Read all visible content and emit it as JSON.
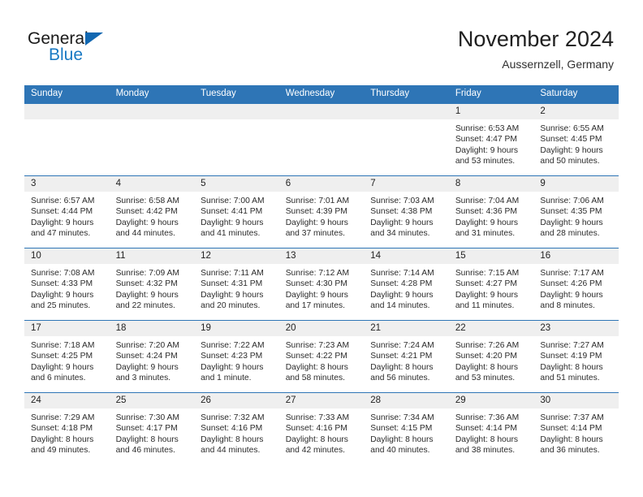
{
  "brand": {
    "name_part1": "General",
    "name_part2": "Blue",
    "triangle_icon": "triangle-icon",
    "accent_dark": "#1167b1",
    "accent_blue": "#1979c3"
  },
  "header": {
    "title": "November 2024",
    "subtitle": "Aussernzell, Germany"
  },
  "theme": {
    "header_blue": "#2e75b6",
    "band_gray": "#efefef",
    "text": "#222222"
  },
  "calendar": {
    "weekday_headers": [
      "Sunday",
      "Monday",
      "Tuesday",
      "Wednesday",
      "Thursday",
      "Friday",
      "Saturday"
    ],
    "weeks": [
      [
        {
          "day": "",
          "sunrise": "",
          "sunset": "",
          "daylight_line1": "",
          "daylight_line2": "",
          "empty": true
        },
        {
          "day": "",
          "sunrise": "",
          "sunset": "",
          "daylight_line1": "",
          "daylight_line2": "",
          "empty": true
        },
        {
          "day": "",
          "sunrise": "",
          "sunset": "",
          "daylight_line1": "",
          "daylight_line2": "",
          "empty": true
        },
        {
          "day": "",
          "sunrise": "",
          "sunset": "",
          "daylight_line1": "",
          "daylight_line2": "",
          "empty": true
        },
        {
          "day": "",
          "sunrise": "",
          "sunset": "",
          "daylight_line1": "",
          "daylight_line2": "",
          "empty": true
        },
        {
          "day": "1",
          "sunrise": "Sunrise: 6:53 AM",
          "sunset": "Sunset: 4:47 PM",
          "daylight_line1": "Daylight: 9 hours",
          "daylight_line2": "and 53 minutes.",
          "empty": false
        },
        {
          "day": "2",
          "sunrise": "Sunrise: 6:55 AM",
          "sunset": "Sunset: 4:45 PM",
          "daylight_line1": "Daylight: 9 hours",
          "daylight_line2": "and 50 minutes.",
          "empty": false
        }
      ],
      [
        {
          "day": "3",
          "sunrise": "Sunrise: 6:57 AM",
          "sunset": "Sunset: 4:44 PM",
          "daylight_line1": "Daylight: 9 hours",
          "daylight_line2": "and 47 minutes.",
          "empty": false
        },
        {
          "day": "4",
          "sunrise": "Sunrise: 6:58 AM",
          "sunset": "Sunset: 4:42 PM",
          "daylight_line1": "Daylight: 9 hours",
          "daylight_line2": "and 44 minutes.",
          "empty": false
        },
        {
          "day": "5",
          "sunrise": "Sunrise: 7:00 AM",
          "sunset": "Sunset: 4:41 PM",
          "daylight_line1": "Daylight: 9 hours",
          "daylight_line2": "and 41 minutes.",
          "empty": false
        },
        {
          "day": "6",
          "sunrise": "Sunrise: 7:01 AM",
          "sunset": "Sunset: 4:39 PM",
          "daylight_line1": "Daylight: 9 hours",
          "daylight_line2": "and 37 minutes.",
          "empty": false
        },
        {
          "day": "7",
          "sunrise": "Sunrise: 7:03 AM",
          "sunset": "Sunset: 4:38 PM",
          "daylight_line1": "Daylight: 9 hours",
          "daylight_line2": "and 34 minutes.",
          "empty": false
        },
        {
          "day": "8",
          "sunrise": "Sunrise: 7:04 AM",
          "sunset": "Sunset: 4:36 PM",
          "daylight_line1": "Daylight: 9 hours",
          "daylight_line2": "and 31 minutes.",
          "empty": false
        },
        {
          "day": "9",
          "sunrise": "Sunrise: 7:06 AM",
          "sunset": "Sunset: 4:35 PM",
          "daylight_line1": "Daylight: 9 hours",
          "daylight_line2": "and 28 minutes.",
          "empty": false
        }
      ],
      [
        {
          "day": "10",
          "sunrise": "Sunrise: 7:08 AM",
          "sunset": "Sunset: 4:33 PM",
          "daylight_line1": "Daylight: 9 hours",
          "daylight_line2": "and 25 minutes.",
          "empty": false
        },
        {
          "day": "11",
          "sunrise": "Sunrise: 7:09 AM",
          "sunset": "Sunset: 4:32 PM",
          "daylight_line1": "Daylight: 9 hours",
          "daylight_line2": "and 22 minutes.",
          "empty": false
        },
        {
          "day": "12",
          "sunrise": "Sunrise: 7:11 AM",
          "sunset": "Sunset: 4:31 PM",
          "daylight_line1": "Daylight: 9 hours",
          "daylight_line2": "and 20 minutes.",
          "empty": false
        },
        {
          "day": "13",
          "sunrise": "Sunrise: 7:12 AM",
          "sunset": "Sunset: 4:30 PM",
          "daylight_line1": "Daylight: 9 hours",
          "daylight_line2": "and 17 minutes.",
          "empty": false
        },
        {
          "day": "14",
          "sunrise": "Sunrise: 7:14 AM",
          "sunset": "Sunset: 4:28 PM",
          "daylight_line1": "Daylight: 9 hours",
          "daylight_line2": "and 14 minutes.",
          "empty": false
        },
        {
          "day": "15",
          "sunrise": "Sunrise: 7:15 AM",
          "sunset": "Sunset: 4:27 PM",
          "daylight_line1": "Daylight: 9 hours",
          "daylight_line2": "and 11 minutes.",
          "empty": false
        },
        {
          "day": "16",
          "sunrise": "Sunrise: 7:17 AM",
          "sunset": "Sunset: 4:26 PM",
          "daylight_line1": "Daylight: 9 hours",
          "daylight_line2": "and 8 minutes.",
          "empty": false
        }
      ],
      [
        {
          "day": "17",
          "sunrise": "Sunrise: 7:18 AM",
          "sunset": "Sunset: 4:25 PM",
          "daylight_line1": "Daylight: 9 hours",
          "daylight_line2": "and 6 minutes.",
          "empty": false
        },
        {
          "day": "18",
          "sunrise": "Sunrise: 7:20 AM",
          "sunset": "Sunset: 4:24 PM",
          "daylight_line1": "Daylight: 9 hours",
          "daylight_line2": "and 3 minutes.",
          "empty": false
        },
        {
          "day": "19",
          "sunrise": "Sunrise: 7:22 AM",
          "sunset": "Sunset: 4:23 PM",
          "daylight_line1": "Daylight: 9 hours",
          "daylight_line2": "and 1 minute.",
          "empty": false
        },
        {
          "day": "20",
          "sunrise": "Sunrise: 7:23 AM",
          "sunset": "Sunset: 4:22 PM",
          "daylight_line1": "Daylight: 8 hours",
          "daylight_line2": "and 58 minutes.",
          "empty": false
        },
        {
          "day": "21",
          "sunrise": "Sunrise: 7:24 AM",
          "sunset": "Sunset: 4:21 PM",
          "daylight_line1": "Daylight: 8 hours",
          "daylight_line2": "and 56 minutes.",
          "empty": false
        },
        {
          "day": "22",
          "sunrise": "Sunrise: 7:26 AM",
          "sunset": "Sunset: 4:20 PM",
          "daylight_line1": "Daylight: 8 hours",
          "daylight_line2": "and 53 minutes.",
          "empty": false
        },
        {
          "day": "23",
          "sunrise": "Sunrise: 7:27 AM",
          "sunset": "Sunset: 4:19 PM",
          "daylight_line1": "Daylight: 8 hours",
          "daylight_line2": "and 51 minutes.",
          "empty": false
        }
      ],
      [
        {
          "day": "24",
          "sunrise": "Sunrise: 7:29 AM",
          "sunset": "Sunset: 4:18 PM",
          "daylight_line1": "Daylight: 8 hours",
          "daylight_line2": "and 49 minutes.",
          "empty": false
        },
        {
          "day": "25",
          "sunrise": "Sunrise: 7:30 AM",
          "sunset": "Sunset: 4:17 PM",
          "daylight_line1": "Daylight: 8 hours",
          "daylight_line2": "and 46 minutes.",
          "empty": false
        },
        {
          "day": "26",
          "sunrise": "Sunrise: 7:32 AM",
          "sunset": "Sunset: 4:16 PM",
          "daylight_line1": "Daylight: 8 hours",
          "daylight_line2": "and 44 minutes.",
          "empty": false
        },
        {
          "day": "27",
          "sunrise": "Sunrise: 7:33 AM",
          "sunset": "Sunset: 4:16 PM",
          "daylight_line1": "Daylight: 8 hours",
          "daylight_line2": "and 42 minutes.",
          "empty": false
        },
        {
          "day": "28",
          "sunrise": "Sunrise: 7:34 AM",
          "sunset": "Sunset: 4:15 PM",
          "daylight_line1": "Daylight: 8 hours",
          "daylight_line2": "and 40 minutes.",
          "empty": false
        },
        {
          "day": "29",
          "sunrise": "Sunrise: 7:36 AM",
          "sunset": "Sunset: 4:14 PM",
          "daylight_line1": "Daylight: 8 hours",
          "daylight_line2": "and 38 minutes.",
          "empty": false
        },
        {
          "day": "30",
          "sunrise": "Sunrise: 7:37 AM",
          "sunset": "Sunset: 4:14 PM",
          "daylight_line1": "Daylight: 8 hours",
          "daylight_line2": "and 36 minutes.",
          "empty": false
        }
      ]
    ]
  }
}
